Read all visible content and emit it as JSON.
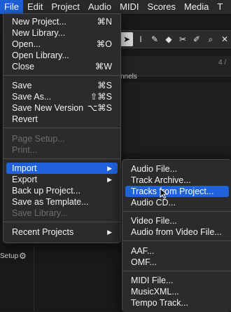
{
  "menubar": {
    "items": [
      "File",
      "Edit",
      "Project",
      "Audio",
      "MIDI",
      "Scores",
      "Media",
      "T"
    ],
    "active_index": 0
  },
  "background": {
    "channels_label": "nnels",
    "pager": "4 /",
    "setup_label": "Setup"
  },
  "toolbar": {
    "tools": [
      "pointer-tool",
      "range-tool",
      "draw-tool",
      "erase-tool",
      "split-tool",
      "glue-tool",
      "zoom-tool",
      "mute-tool"
    ]
  },
  "file_menu": {
    "items": [
      {
        "label": "New Project...",
        "shortcut": "⌘N",
        "enabled": true
      },
      {
        "label": "New Library...",
        "shortcut": "",
        "enabled": true
      },
      {
        "label": "Open...",
        "shortcut": "⌘O",
        "enabled": true
      },
      {
        "label": "Open Library...",
        "shortcut": "",
        "enabled": true
      },
      {
        "label": "Close",
        "shortcut": "⌘W",
        "enabled": true
      },
      {
        "label": "Save",
        "shortcut": "⌘S",
        "enabled": true
      },
      {
        "label": "Save As...",
        "shortcut": "⇧⌘S",
        "enabled": true
      },
      {
        "label": "Save New Version",
        "shortcut": "⌥⌘S",
        "enabled": true
      },
      {
        "label": "Revert",
        "shortcut": "",
        "enabled": true
      },
      {
        "label": "Page Setup...",
        "shortcut": "",
        "enabled": false
      },
      {
        "label": "Print...",
        "shortcut": "",
        "enabled": false
      },
      {
        "label": "Import",
        "shortcut": "",
        "enabled": true,
        "submenu": true,
        "highlighted": true
      },
      {
        "label": "Export",
        "shortcut": "",
        "enabled": true,
        "submenu": true
      },
      {
        "label": "Back up Project...",
        "shortcut": "",
        "enabled": true
      },
      {
        "label": "Save as Template...",
        "shortcut": "",
        "enabled": true
      },
      {
        "label": "Save Library...",
        "shortcut": "",
        "enabled": false
      },
      {
        "label": "Recent Projects",
        "shortcut": "",
        "enabled": true,
        "submenu": true
      }
    ]
  },
  "import_menu": {
    "items": [
      {
        "label": "Audio File...",
        "highlighted": false
      },
      {
        "label": "Track Archive...",
        "highlighted": false
      },
      {
        "label": "Tracks from Project...",
        "highlighted": true
      },
      {
        "label": "Audio CD...",
        "highlighted": false
      },
      {
        "label": "Video File...",
        "highlighted": false
      },
      {
        "label": "Audio from Video File...",
        "highlighted": false
      },
      {
        "label": "AAF...",
        "highlighted": false
      },
      {
        "label": "OMF...",
        "highlighted": false
      },
      {
        "label": "MIDI File...",
        "highlighted": false
      },
      {
        "label": "MusicXML...",
        "highlighted": false
      },
      {
        "label": "Tempo Track...",
        "highlighted": false
      }
    ]
  },
  "colors": {
    "highlight": "#1f62dc",
    "menu_bg": "#2c2c2e"
  }
}
